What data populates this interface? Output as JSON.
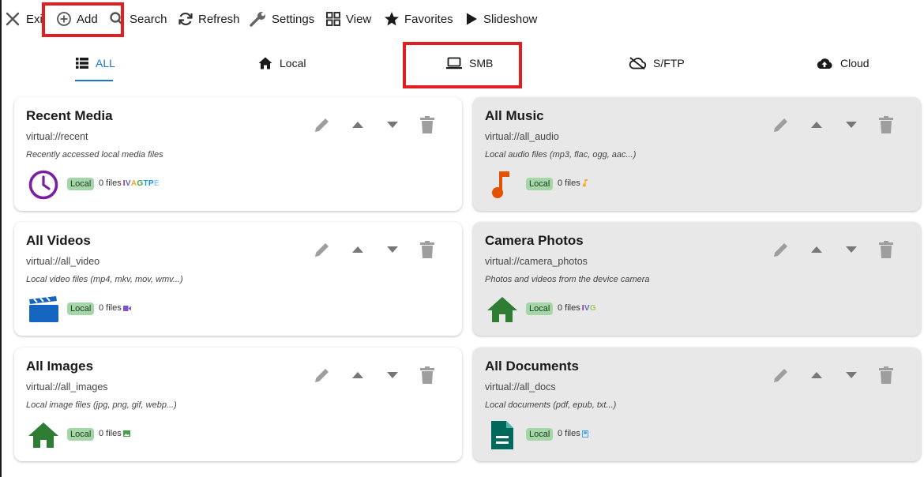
{
  "toolbar": {
    "exit_label": "Exi",
    "add_label": "Add",
    "search_label": "Search",
    "refresh_label": "Refresh",
    "settings_label": "Settings",
    "view_label": "View",
    "favorites_label": "Favorites",
    "slideshow_label": "Slideshow"
  },
  "tabs": [
    {
      "label": "ALL",
      "icon": "list-icon",
      "active": true
    },
    {
      "label": "Local",
      "icon": "home-icon",
      "active": false
    },
    {
      "label": "SMB",
      "icon": "laptop-icon",
      "active": false
    },
    {
      "label": "S/FTP",
      "icon": "cloud-off-icon",
      "active": false
    },
    {
      "label": "Cloud",
      "icon": "cloud-upload-icon",
      "active": false
    }
  ],
  "cards": [
    {
      "title": "Recent Media",
      "path": "virtual://recent",
      "desc": "Recently accessed local media files",
      "badge": "Local",
      "files": "0 files",
      "icon": "clock-icon",
      "types": "IVAGTPE"
    },
    {
      "title": "All Music",
      "path": "virtual://all_audio",
      "desc": "Local audio files (mp3, flac, ogg, aac...)",
      "badge": "Local",
      "files": "0 files",
      "icon": "music-note-icon",
      "types": ""
    },
    {
      "title": "All Videos",
      "path": "virtual://all_video",
      "desc": "Local video files (mp4, mkv, mov, wmv...)",
      "badge": "Local",
      "files": "0 files",
      "icon": "clapperboard-icon",
      "types": ""
    },
    {
      "title": "Camera Photos",
      "path": "virtual://camera_photos",
      "desc": "Photos and videos from the device camera",
      "badge": "Local",
      "files": "0 files",
      "icon": "home-icon",
      "types": "IVG"
    },
    {
      "title": "All Images",
      "path": "virtual://all_images",
      "desc": "Local image files (jpg, png, gif, webp...)",
      "badge": "Local",
      "files": "0 files",
      "icon": "home-icon",
      "types": ""
    },
    {
      "title": "All Documents",
      "path": "virtual://all_docs",
      "desc": "Local documents (pdf, epub, txt...)",
      "badge": "Local",
      "files": "0 files",
      "icon": "document-icon",
      "types": ""
    }
  ],
  "colors": {
    "accent": "#1976d2",
    "highlight_box": "#e02020",
    "badge_bg": "#a5d6a7",
    "card_grey": "#e8e8e8",
    "clock": "#7b1fa2",
    "music": "#e65100",
    "video": "#1565c0",
    "home": "#2e7d32",
    "document": "#00695c"
  }
}
